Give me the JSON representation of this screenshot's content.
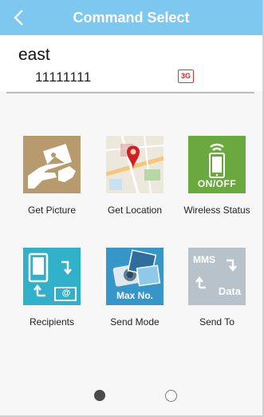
{
  "header": {
    "title": "Command Select",
    "back_icon": "chevron-left-icon"
  },
  "device": {
    "name": "east",
    "number": "11111111",
    "network_badge": "3G"
  },
  "commands": [
    {
      "label": "Get Picture",
      "icon": "picture-icon",
      "color": "#b89a6f"
    },
    {
      "label": "Get Location",
      "icon": "map-pin-icon",
      "color": "#e7e3d6"
    },
    {
      "label": "Wireless Status",
      "icon": "phone-wifi-icon",
      "color": "#69a93d",
      "badge": "ON/OFF"
    },
    {
      "label": "Recipients",
      "icon": "recipients-icon",
      "color": "#30b1c9",
      "badge": "@"
    },
    {
      "label": "Send Mode",
      "icon": "camera-icon",
      "color": "#3596c7",
      "badge": "Max No."
    },
    {
      "label": "Send To",
      "icon": "mms-data-icon",
      "color": "#b7c2ca",
      "badge_top": "MMS",
      "badge_bottom": "Data"
    }
  ],
  "pager": {
    "pages": 2,
    "current": 1
  }
}
